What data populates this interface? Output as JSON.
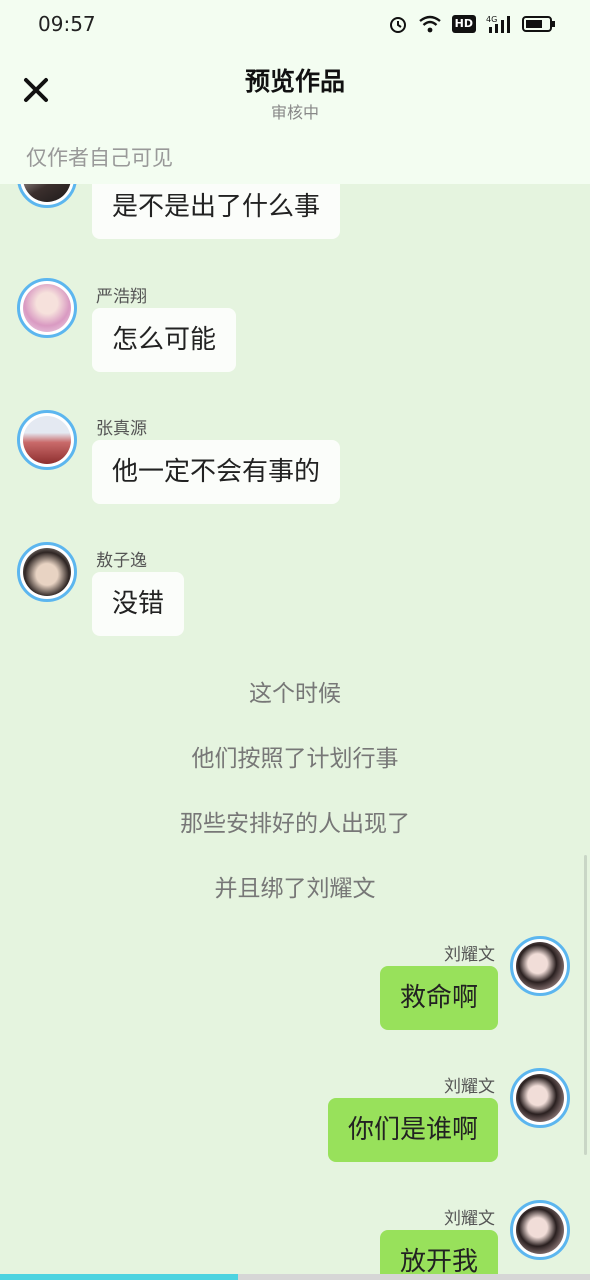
{
  "status": {
    "time": "09:57",
    "icons": [
      "alarm-icon",
      "wifi-icon",
      "hd-icon",
      "signal-4g-icon",
      "battery-icon"
    ],
    "hd_label": "HD",
    "network_label": "4G"
  },
  "header": {
    "title": "预览作品",
    "subtitle": "审核中",
    "close_icon": "close-icon",
    "visibility_note": "仅作者自己可见"
  },
  "messages": [
    {
      "sender": "",
      "text": "是不是出了什么事",
      "side": "left"
    },
    {
      "sender": "严浩翔",
      "text": "怎么可能",
      "side": "left"
    },
    {
      "sender": "张真源",
      "text": "他一定不会有事的",
      "side": "left"
    },
    {
      "sender": "敖子逸",
      "text": "没错",
      "side": "left"
    }
  ],
  "narration": [
    "这个时候",
    "他们按照了计划行事",
    "那些安排好的人出现了",
    "并且绑了刘耀文"
  ],
  "replies": [
    {
      "sender": "刘耀文",
      "text": "救命啊",
      "side": "right"
    },
    {
      "sender": "刘耀文",
      "text": "你们是谁啊",
      "side": "right"
    },
    {
      "sender": "刘耀文",
      "text": "放开我",
      "side": "right"
    }
  ],
  "colors": {
    "background": "#e5f4df",
    "header_bg": "#f3fdf1",
    "bubble_left": "#fbfdfa",
    "bubble_right": "#98e15b",
    "avatar_ring": "#5cb6ef"
  }
}
